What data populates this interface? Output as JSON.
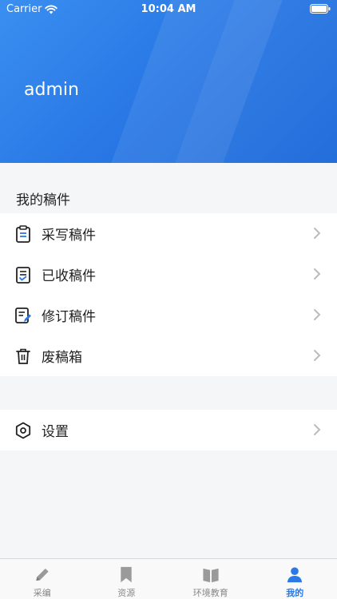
{
  "status_bar": {
    "carrier": "Carrier",
    "time": "10:04 AM"
  },
  "profile": {
    "username": "admin"
  },
  "drafts_section": {
    "title": "我的稿件",
    "items": [
      {
        "label": "采写稿件",
        "icon": "clipboard-icon"
      },
      {
        "label": "已收稿件",
        "icon": "checklist-icon"
      },
      {
        "label": " 修订稿件",
        "icon": "edit-document-icon"
      },
      {
        "label": "废稿箱",
        "icon": "trash-icon"
      }
    ]
  },
  "settings_section": {
    "items": [
      {
        "label": "设置",
        "icon": "hexagon-settings-icon"
      }
    ]
  },
  "tabbar": {
    "tabs": [
      {
        "label": "采编",
        "icon": "pen-icon",
        "active": false
      },
      {
        "label": "资源",
        "icon": "bookmark-icon",
        "active": false
      },
      {
        "label": "环境教育",
        "icon": "book-icon",
        "active": false
      },
      {
        "label": "我的",
        "icon": "person-icon",
        "active": true
      }
    ]
  },
  "colors": {
    "accent": "#2a79e6",
    "header_start": "#3a8ff0",
    "header_end": "#1565d8"
  }
}
